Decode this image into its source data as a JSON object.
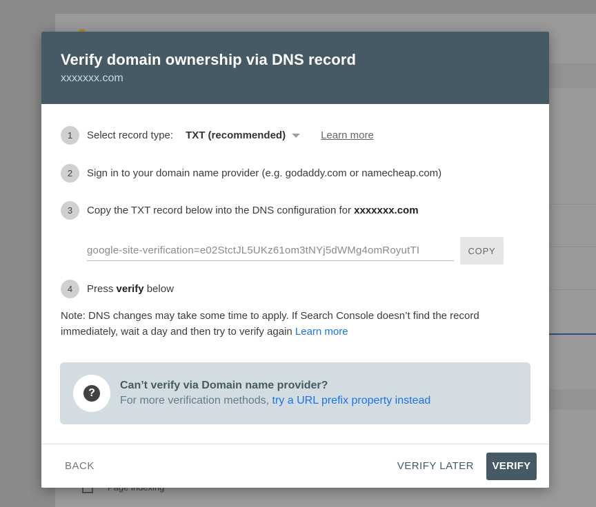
{
  "background": {
    "partial_label": "Page indexing"
  },
  "dialog": {
    "title": "Verify domain ownership via DNS record",
    "subtitle": "xxxxxxx.com"
  },
  "steps": [
    {
      "number": "1",
      "label": "Select record type:",
      "select_value": "TXT (recommended)",
      "link": "Learn more"
    },
    {
      "number": "2",
      "text": "Sign in to your domain name provider (e.g. godaddy.com or namecheap.com)"
    },
    {
      "number": "3",
      "text_prefix": "Copy the TXT record below into the DNS configuration for ",
      "domain": "xxxxxxx.com"
    },
    {
      "number": "4",
      "text_prefix": "Press ",
      "bold": "verify",
      "text_suffix": " below"
    }
  ],
  "record": {
    "value": "google-site-verification=e02StctJL5UKz61om3tNYj5dWMg4omRoyutTI",
    "copy_label": "COPY"
  },
  "note": {
    "text": "Note: DNS changes may take some time to apply. If Search Console doesn’t find the record immediately, wait a day and then try to verify again ",
    "link": "Learn more"
  },
  "info": {
    "title": "Can’t verify via Domain name provider?",
    "text": "For more verification methods, ",
    "link": "try a URL prefix property instead"
  },
  "footer": {
    "back": "BACK",
    "verify_later": "VERIFY LATER",
    "verify": "VERIFY"
  },
  "colors": {
    "header_bg": "#455a64",
    "accent_link": "#1a73e8",
    "info_bg": "#d3dce0"
  }
}
